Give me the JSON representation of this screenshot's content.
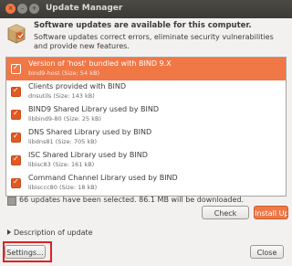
{
  "window": {
    "title": "Update Manager",
    "close_glyph": "×",
    "min_glyph": "–",
    "max_glyph": "+"
  },
  "header": {
    "title": "Software updates are available for this computer.",
    "description": "Software updates correct errors, eliminate security vulnerabilities and provide new features.",
    "icon": "package-icon"
  },
  "updates": [
    {
      "title": "Version of 'host' bundled with BIND 9.X",
      "subtitle": "bind9-host (Size: 54 kB)",
      "checked": true,
      "selected": true
    },
    {
      "title": "Clients provided with BIND",
      "subtitle": "dnsutils (Size: 143 kB)",
      "checked": true,
      "selected": false
    },
    {
      "title": "BIND9 Shared Library used by BIND",
      "subtitle": "libbind9-80 (Size: 25 kB)",
      "checked": true,
      "selected": false
    },
    {
      "title": "DNS Shared Library used by BIND",
      "subtitle": "libdns81 (Size: 705 kB)",
      "checked": true,
      "selected": false
    },
    {
      "title": "ISC Shared Library used by BIND",
      "subtitle": "libisc83 (Size: 161 kB)",
      "checked": true,
      "selected": false
    },
    {
      "title": "Command Channel Library used by BIND",
      "subtitle": "libisccc80 (Size: 18 kB)",
      "checked": true,
      "selected": false
    }
  ],
  "status": {
    "text": "66 updates have been selected. 86.1 MB will be downloaded."
  },
  "buttons": {
    "check": "Check",
    "install": "Install Updates",
    "settings": "Settings...",
    "close": "Close"
  },
  "description_expander": "Description of update",
  "colors": {
    "accent": "#f07746",
    "titlebar": "#3b3a36",
    "highlight_box": "#e02020"
  }
}
